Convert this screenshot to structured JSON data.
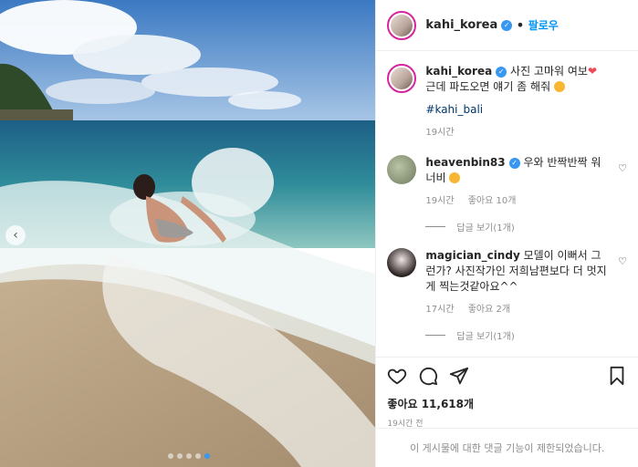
{
  "header": {
    "username": "kahi_korea",
    "separator": "•",
    "follow_label": "팔로우"
  },
  "caption": {
    "username": "kahi_korea",
    "line1": "사진 고마워 여보",
    "line2": "근데 파도오면 얘기 좀 해줘",
    "hashtag": "#kahi_bali",
    "time": "19시간"
  },
  "comments": [
    {
      "username": "heavenbin83",
      "text": "우와 반짝반짝 워너비",
      "time": "19시간",
      "likes": "좋아요 10개",
      "replies": "답글 보기(1개)"
    },
    {
      "username": "magician_cindy",
      "text": "모델이 이뻐서 그런가? 사진작가인 저희남편보다 더 멋지게 찍는것같아요^^",
      "time": "17시간",
      "likes": "좋아요 2개",
      "replies": "답글 보기(1개)"
    }
  ],
  "footer": {
    "likes": "좋아요 11,618개",
    "time_ago": "19시간 전",
    "comments_disabled": "이 게시물에 대한 댓글 기능이 제한되었습니다."
  },
  "colors": {
    "accent": "#0095f6",
    "verified": "#3897f0",
    "heart": "#ed4956"
  },
  "carousel": {
    "count": 5,
    "active_index": 4
  }
}
